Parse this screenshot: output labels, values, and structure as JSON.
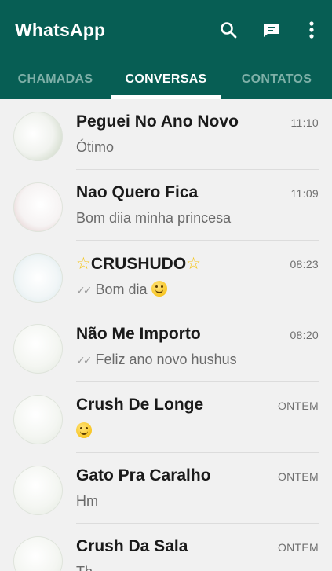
{
  "header": {
    "title": "WhatsApp",
    "icons": [
      "search-icon",
      "new-chat-icon",
      "more-vert-icon"
    ]
  },
  "tabs": [
    {
      "label": "CHAMADAS",
      "active": false
    },
    {
      "label": "CONVERSAS",
      "active": true
    },
    {
      "label": "CONTATOS",
      "active": false
    }
  ],
  "chats": [
    {
      "name": "Peguei No Ano Novo",
      "preview": "Ótimo",
      "time": "11:10",
      "read_ticks": false
    },
    {
      "name": "Nao Quero Fica",
      "preview": "Bom diia minha princesa",
      "time": "11:09",
      "read_ticks": false
    },
    {
      "name_star_left": "☆",
      "name": "CRUSHUDO",
      "name_star_right": "☆",
      "preview": "Bom dia",
      "preview_emoji": "smile-emoji",
      "time": "08:23",
      "read_ticks": true
    },
    {
      "name": "Não Me Importo",
      "preview": "Feliz ano novo hushus",
      "time": "08:20",
      "read_ticks": true
    },
    {
      "name": "Crush De Longe",
      "preview": "",
      "preview_emoji": "smile-emoji",
      "time": "ONTEM",
      "read_ticks": false
    },
    {
      "name": "Gato Pra Caralho",
      "preview": "Hm",
      "time": "ONTEM",
      "read_ticks": false
    },
    {
      "name": "Crush Da Sala",
      "preview": "Th",
      "time": "ONTEM",
      "read_ticks": false
    }
  ],
  "colors": {
    "appbar": "#075e54",
    "tab_inactive": "#7fb0a8",
    "tab_active": "#ffffff",
    "list_bg": "#f1f1f1"
  }
}
